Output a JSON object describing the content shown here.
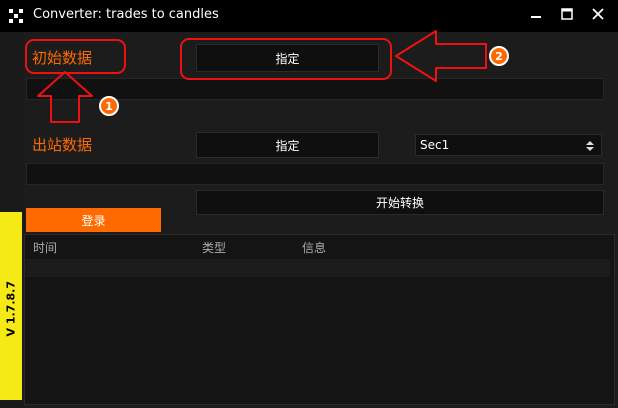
{
  "window": {
    "title": "Converter: trades to candles",
    "controls": [
      "minimize-icon",
      "maximize-icon",
      "close-icon"
    ]
  },
  "source": {
    "label": "初始数据",
    "specify_button": "指定",
    "path_value": ""
  },
  "output": {
    "label": "出站数据",
    "specify_button": "指定",
    "timeframe_value": "Sec1",
    "path_value": ""
  },
  "actions": {
    "convert_button": "开始转换",
    "login_button": "登录"
  },
  "log": {
    "columns": [
      "时间",
      "类型",
      "信息"
    ],
    "rows": []
  },
  "version": "V 1.7.8.7",
  "annotations": {
    "marker_1": "1",
    "marker_2": "2"
  },
  "colors": {
    "accent": "#ff6a00",
    "annotation": "#e11111",
    "ribbon": "#f5ea16",
    "background": "#1a1a1a"
  }
}
